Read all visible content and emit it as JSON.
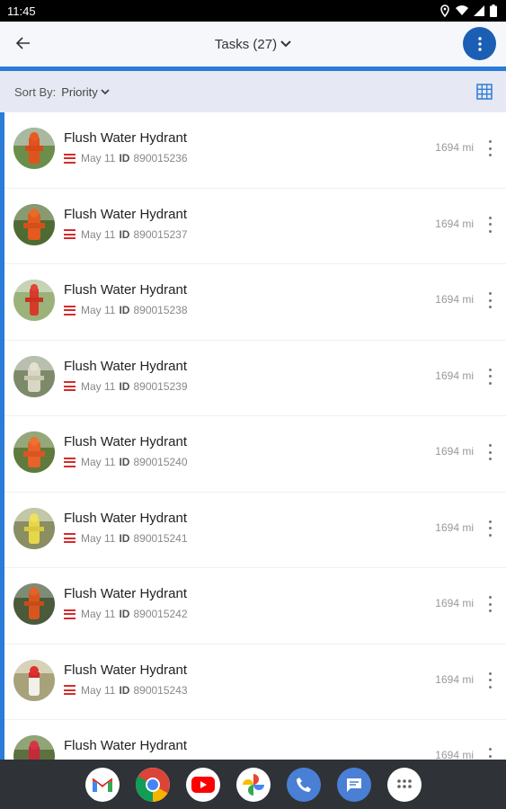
{
  "status": {
    "time": "11:45"
  },
  "header": {
    "title": "Tasks (27)"
  },
  "sort": {
    "label": "Sort By:",
    "value": "Priority"
  },
  "tasks": [
    {
      "title": "Flush Water Hydrant",
      "date": "May 11",
      "id_label": "ID",
      "id": "890015236",
      "distance": "1694 mi"
    },
    {
      "title": "Flush Water Hydrant",
      "date": "May 11",
      "id_label": "ID",
      "id": "890015237",
      "distance": "1694 mi"
    },
    {
      "title": "Flush Water Hydrant",
      "date": "May 11",
      "id_label": "ID",
      "id": "890015238",
      "distance": "1694 mi"
    },
    {
      "title": "Flush Water Hydrant",
      "date": "May 11",
      "id_label": "ID",
      "id": "890015239",
      "distance": "1694 mi"
    },
    {
      "title": "Flush Water Hydrant",
      "date": "May 11",
      "id_label": "ID",
      "id": "890015240",
      "distance": "1694 mi"
    },
    {
      "title": "Flush Water Hydrant",
      "date": "May 11",
      "id_label": "ID",
      "id": "890015241",
      "distance": "1694 mi"
    },
    {
      "title": "Flush Water Hydrant",
      "date": "May 11",
      "id_label": "ID",
      "id": "890015242",
      "distance": "1694 mi"
    },
    {
      "title": "Flush Water Hydrant",
      "date": "May 11",
      "id_label": "ID",
      "id": "890015243",
      "distance": "1694 mi"
    },
    {
      "title": "Flush Water Hydrant",
      "date": "",
      "id_label": "",
      "id": "",
      "distance": "1694 mi"
    }
  ],
  "dock": {
    "apps": [
      "gmail-icon",
      "chrome-icon",
      "youtube-icon",
      "photos-icon",
      "phone-icon",
      "messages-icon",
      "app-drawer-icon"
    ]
  },
  "colors": {
    "accent": "#2b7bd8",
    "fab": "#1a5fb4",
    "priority_high": "#d62c2c",
    "sort_bar": "#e6e9f3"
  }
}
